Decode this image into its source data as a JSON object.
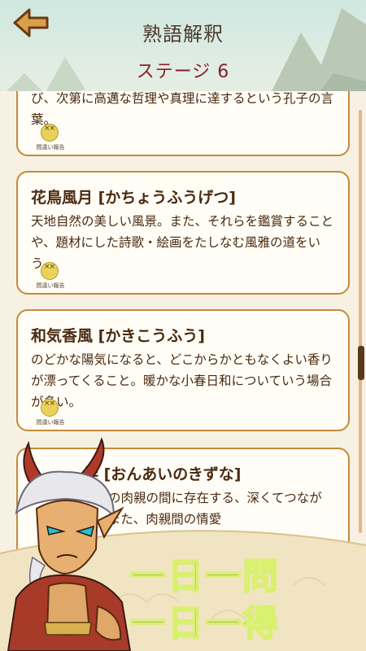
{
  "header": {
    "title": "熟語解釈",
    "stage": "ステージ 6"
  },
  "cards": [
    {
      "title": "",
      "body": "び、次第に高邁な哲理や真理に達するという孔子の言葉。",
      "report_label": "間違い報告"
    },
    {
      "title": "花鳥風月 [かちょうふうげつ]",
      "body": "天地自然の美しい風景。また、それらを鑑賞することや、題材にした詩歌・絵画をたしなむ風雅の道をいう。",
      "report_label": "間違い報告"
    },
    {
      "title": "和気香風 [かきこうふう]",
      "body": "のどかな陽気になると、どこからかともなくよい香りが漂ってくること。暖かな小春日和についていう場合が多い。",
      "report_label": "間違い報告"
    },
    {
      "title": "絆 [おんあいのきずな]",
      "body": "などの肉親の間に存在する、深くてつながり。また、肉親間の情愛",
      "report_label": ""
    }
  ],
  "banner": {
    "line1": "一日一問",
    "line2": "一日一得"
  },
  "colors": {
    "accent": "#8a1e2a",
    "card_border": "#c58a3a",
    "slogan_outline": "#d9f070"
  }
}
